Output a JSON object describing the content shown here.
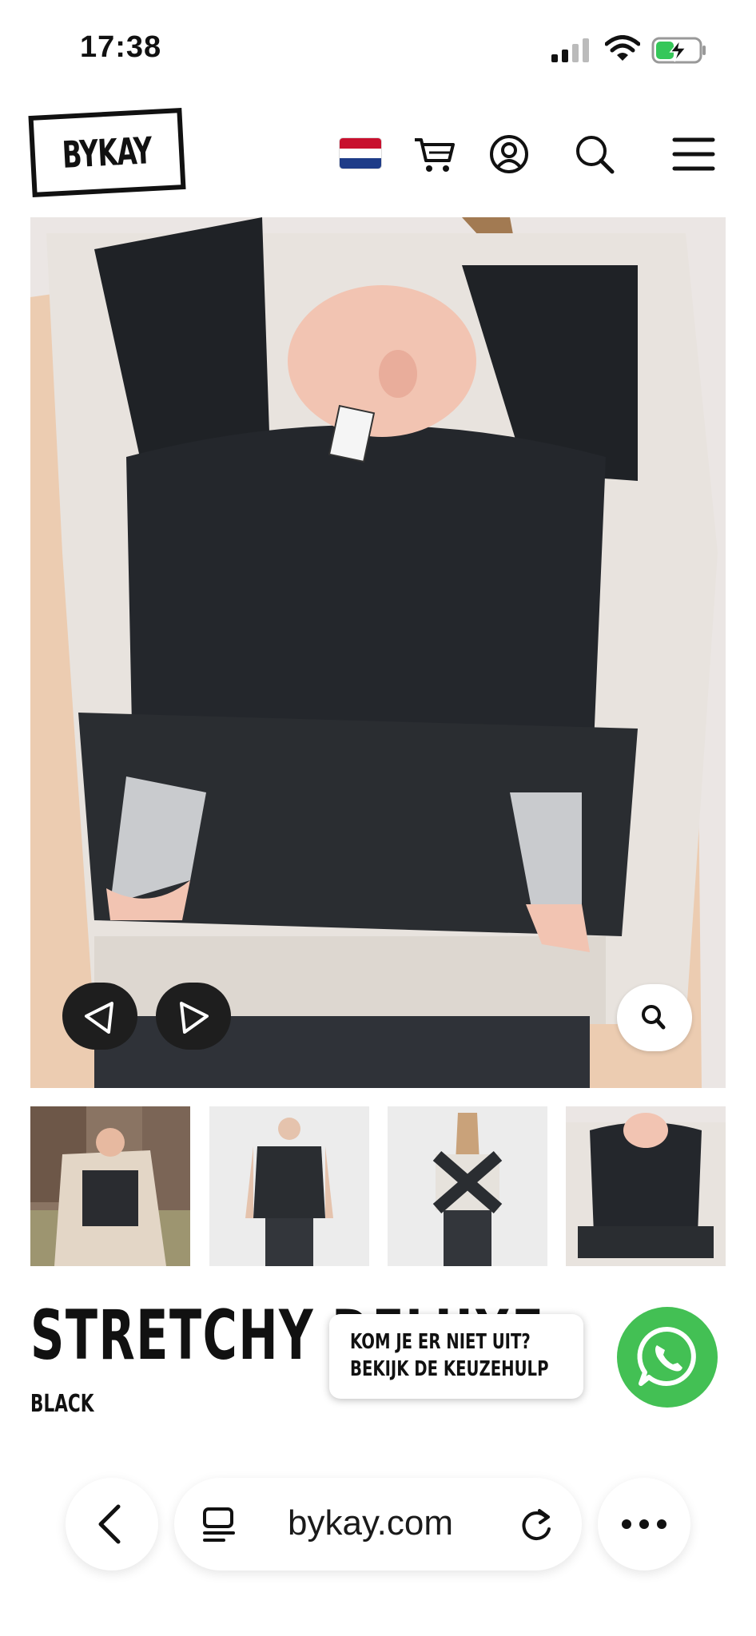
{
  "status_bar": {
    "time": "17:38",
    "battery_color": "#35c759"
  },
  "header": {
    "logo_text": "BYKAY",
    "icons": [
      "netherlands-flag-icon",
      "cart-icon",
      "account-icon",
      "search-icon",
      "menu-icon"
    ]
  },
  "gallery": {
    "controls": [
      "previous-arrow-icon",
      "next-arrow-icon",
      "zoom-icon"
    ],
    "thumbnails": [
      "thumbnail-city",
      "thumbnail-front",
      "thumbnail-back",
      "thumbnail-closeup"
    ]
  },
  "product": {
    "title": "STRETCHY DELUXE",
    "variant": "BLACK"
  },
  "help": {
    "line1": "KOM JE ER NIET UIT?",
    "line2": "BEKIJK DE KEUZEHULP",
    "whatsapp_color": "#43c054"
  },
  "browser": {
    "url": "bykay.com"
  }
}
